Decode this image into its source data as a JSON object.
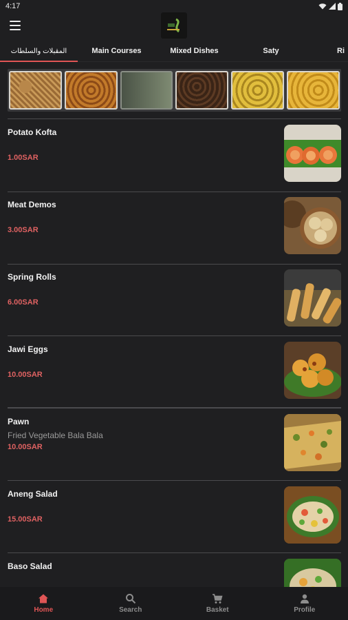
{
  "status": {
    "time": "4:17"
  },
  "tabs": [
    {
      "label": "المقبلات والسلطات"
    },
    {
      "label": "Main Courses"
    },
    {
      "label": "Mixed Dishes"
    },
    {
      "label": "Saty"
    },
    {
      "label": "Ri"
    }
  ],
  "items": [
    {
      "name": "Potato Kofta",
      "desc": "",
      "price": "1.00SAR"
    },
    {
      "name": "Meat Demos",
      "desc": "",
      "price": "3.00SAR"
    },
    {
      "name": "Spring Rolls",
      "desc": "",
      "price": "6.00SAR"
    },
    {
      "name": "Jawi Eggs",
      "desc": "",
      "price": "10.00SAR"
    },
    {
      "name": "Pawn",
      "desc": "Fried Vegetable Bala Bala",
      "price": "10.00SAR"
    },
    {
      "name": "Aneng Salad",
      "desc": "",
      "price": "15.00SAR"
    },
    {
      "name": "Baso Salad",
      "desc": "",
      "price": ""
    }
  ],
  "nav": [
    {
      "label": "Home",
      "icon": "home-icon"
    },
    {
      "label": "Search",
      "icon": "search-icon"
    },
    {
      "label": "Basket",
      "icon": "cart-icon"
    },
    {
      "label": "Profile",
      "icon": "person-icon"
    }
  ],
  "colors": {
    "accent": "#e05555",
    "price": "#e06262",
    "background": "#1f1f21"
  }
}
